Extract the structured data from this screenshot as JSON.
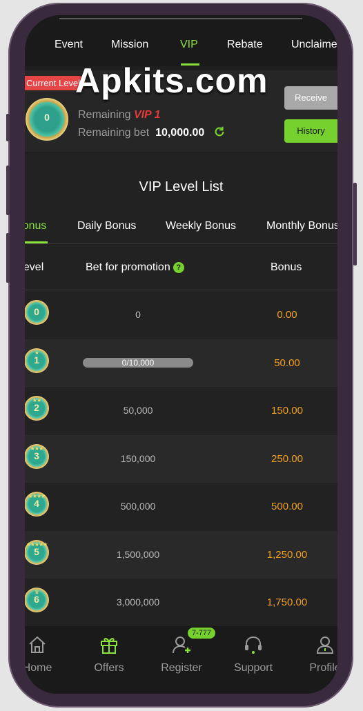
{
  "tabs": [
    "Event",
    "Mission",
    "VIP",
    "Rebate",
    "Unclaimed"
  ],
  "active_tab": "VIP",
  "watermark": "Apkits.com",
  "current_level_tag": "Current Level",
  "current_medal_level": "0",
  "remaining_label": "Remaining",
  "remaining_vip": "VIP 1",
  "remaining_bet_label": "Remaining bet",
  "remaining_bet_value": "10,000.00",
  "receive_label": "Receive",
  "history_label": "History",
  "list_title": "VIP Level List",
  "bonus_tabs": [
    "Bonus",
    "Daily Bonus",
    "Weekly Bonus",
    "Monthly Bonus"
  ],
  "columns": {
    "level": "Level",
    "bet": "Bet for promotion",
    "bonus": "Bonus"
  },
  "help_icon": "?",
  "levels": [
    {
      "level": "0",
      "bet": "0",
      "bonus": "0.00"
    },
    {
      "level": "1",
      "bet": "0/10,000",
      "bonus": "50.00",
      "progress": 0
    },
    {
      "level": "2",
      "bet": "50,000",
      "bonus": "150.00"
    },
    {
      "level": "3",
      "bet": "150,000",
      "bonus": "250.00"
    },
    {
      "level": "4",
      "bet": "500,000",
      "bonus": "500.00"
    },
    {
      "level": "5",
      "bet": "1,500,000",
      "bonus": "1,250.00"
    },
    {
      "level": "6",
      "bet": "3,000,000",
      "bonus": "1,750.00"
    }
  ],
  "nav": [
    {
      "label": "Home",
      "icon": "home-icon"
    },
    {
      "label": "Offers",
      "icon": "gift-icon"
    },
    {
      "label": "Register",
      "icon": "add-user-icon"
    },
    {
      "label": "Support",
      "icon": "headset-icon"
    },
    {
      "label": "Profile",
      "icon": "profile-icon"
    }
  ],
  "register_badge": "7-777",
  "colors": {
    "accent": "#8be23a",
    "bonus": "#f0a020",
    "danger": "#e64545"
  }
}
